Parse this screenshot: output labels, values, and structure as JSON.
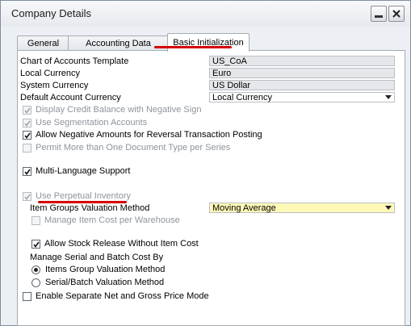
{
  "window": {
    "title": "Company Details"
  },
  "tabs": [
    {
      "label": "General"
    },
    {
      "label": "Accounting Data"
    },
    {
      "label": "Basic Initialization"
    }
  ],
  "fields": {
    "coa_template": {
      "label": "Chart of Accounts Template",
      "value": "US_CoA"
    },
    "local_currency": {
      "label": "Local Currency",
      "value": "Euro"
    },
    "system_currency": {
      "label": "System Currency",
      "value": "US Dollar"
    },
    "default_account_currency": {
      "label": "Default Account Currency",
      "value": "Local Currency"
    },
    "valuation_method": {
      "label": "Item Groups Valuation Method",
      "value": "Moving Average"
    }
  },
  "checkboxes": {
    "display_credit": {
      "label": "Display Credit Balance with Negative Sign",
      "checked": true,
      "enabled": false
    },
    "segmentation": {
      "label": "Use Segmentation Accounts",
      "checked": true,
      "enabled": false
    },
    "negative_amounts": {
      "label": "Allow Negative Amounts for Reversal Transaction Posting",
      "checked": true,
      "enabled": true
    },
    "multi_doc_type": {
      "label": "Permit More than One Document Type per Series",
      "checked": false,
      "enabled": false
    },
    "multi_language": {
      "label": "Multi-Language Support",
      "checked": true,
      "enabled": true
    },
    "perpetual_inventory": {
      "label": "Use Perpetual Inventory",
      "checked": true,
      "enabled": false
    },
    "cost_per_warehouse": {
      "label": "Manage Item Cost per Warehouse",
      "checked": false,
      "enabled": false
    },
    "stock_release": {
      "label": "Allow Stock Release Without Item Cost",
      "checked": true,
      "enabled": true
    },
    "separate_price_mode": {
      "label": "Enable Separate Net and Gross Price Mode",
      "checked": false,
      "enabled": true
    }
  },
  "serial_batch": {
    "heading": "Manage Serial and Batch Cost By",
    "options": [
      {
        "label": "Items Group Valuation Method",
        "selected": true
      },
      {
        "label": "Serial/Batch Valuation Method",
        "selected": false
      }
    ]
  },
  "colors": {
    "highlight": "#d40000",
    "yellow_field": "#fff9b8"
  }
}
